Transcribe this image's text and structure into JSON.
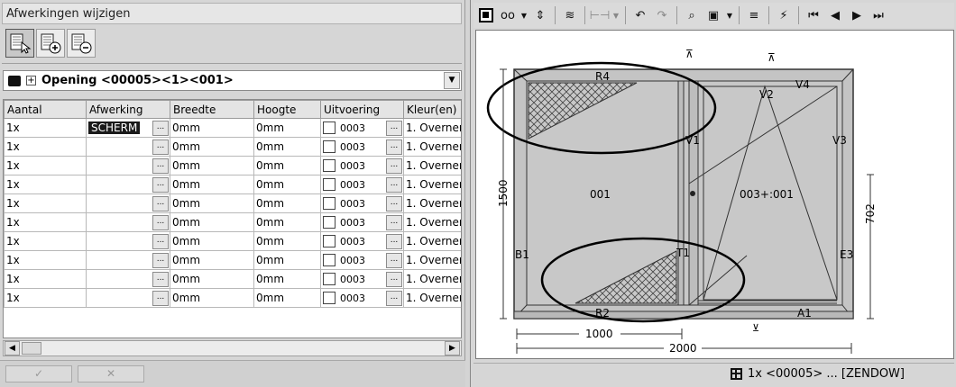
{
  "panel": {
    "title": "Afwerkingen wijzigen"
  },
  "toolbar_left": {
    "icons": [
      "select-cursor-icon",
      "add-icon",
      "remove-icon"
    ]
  },
  "opening": {
    "label": "Opening <00005><1><001>",
    "expand_symbol": "+"
  },
  "table": {
    "columns": [
      "Aantal",
      "Afwerking",
      "Breedte",
      "Hoogte",
      "Uitvoering",
      "Kleur(en)"
    ],
    "ellipsis": "...",
    "rows": [
      {
        "aantal": "1x",
        "afwerking": "SCHERM",
        "breedte": "0mm",
        "hoogte": "0mm",
        "uitvoering": "0003",
        "kleur": "1. Overner"
      },
      {
        "aantal": "1x",
        "afwerking": "",
        "breedte": "0mm",
        "hoogte": "0mm",
        "uitvoering": "0003",
        "kleur": "1. Overner"
      },
      {
        "aantal": "1x",
        "afwerking": "",
        "breedte": "0mm",
        "hoogte": "0mm",
        "uitvoering": "0003",
        "kleur": "1. Overner"
      },
      {
        "aantal": "1x",
        "afwerking": "",
        "breedte": "0mm",
        "hoogte": "0mm",
        "uitvoering": "0003",
        "kleur": "1. Overner"
      },
      {
        "aantal": "1x",
        "afwerking": "",
        "breedte": "0mm",
        "hoogte": "0mm",
        "uitvoering": "0003",
        "kleur": "1. Overner"
      },
      {
        "aantal": "1x",
        "afwerking": "",
        "breedte": "0mm",
        "hoogte": "0mm",
        "uitvoering": "0003",
        "kleur": "1. Overner"
      },
      {
        "aantal": "1x",
        "afwerking": "",
        "breedte": "0mm",
        "hoogte": "0mm",
        "uitvoering": "0003",
        "kleur": "1. Overner"
      },
      {
        "aantal": "1x",
        "afwerking": "",
        "breedte": "0mm",
        "hoogte": "0mm",
        "uitvoering": "0003",
        "kleur": "1. Overner"
      },
      {
        "aantal": "1x",
        "afwerking": "",
        "breedte": "0mm",
        "hoogte": "0mm",
        "uitvoering": "0003",
        "kleur": "1. Overner"
      },
      {
        "aantal": "1x",
        "afwerking": "",
        "breedte": "0mm",
        "hoogte": "0mm",
        "uitvoering": "0003",
        "kleur": "1. Overner"
      }
    ]
  },
  "buttons": {
    "ok_symbol": "✓",
    "cancel_symbol": "✕"
  },
  "drawing": {
    "labels": {
      "r4": "R4",
      "v4": "V4",
      "v1": "V1",
      "v3": "V3",
      "b1": "B1",
      "e3": "E3",
      "t1": "T1",
      "r2": "R2",
      "v2": "V2",
      "a1": "A1",
      "pane1": "001",
      "pane2": "003+:001"
    },
    "dimensions": {
      "height": "1500",
      "width_total": "2000",
      "width_part": "1000",
      "height_part": "702"
    }
  },
  "status": {
    "text": "1x <00005> ... [ZENDOW]"
  }
}
